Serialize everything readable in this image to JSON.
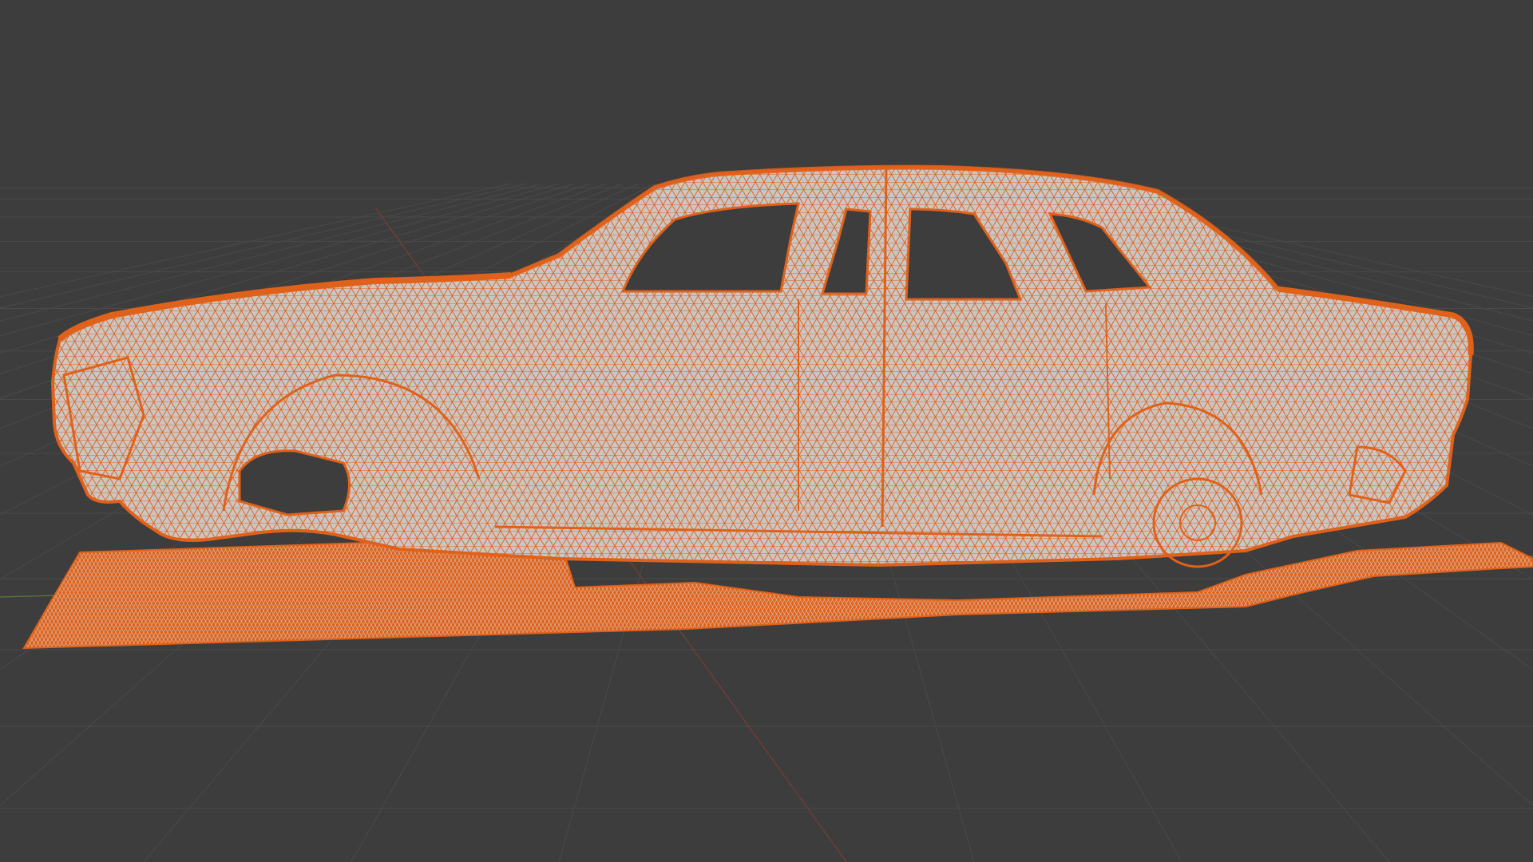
{
  "viewport": {
    "background_color": "#3d3d3d",
    "grid_line_color": "#4a4a4a",
    "x_axis_color": "#7a3c3c",
    "y_axis_color": "#5b7a3a",
    "grid_visible": true
  },
  "mesh": {
    "display_mode": "wireframe",
    "selected": true,
    "wire_color": "#e0611a",
    "face_color": "#c9c6c4"
  }
}
